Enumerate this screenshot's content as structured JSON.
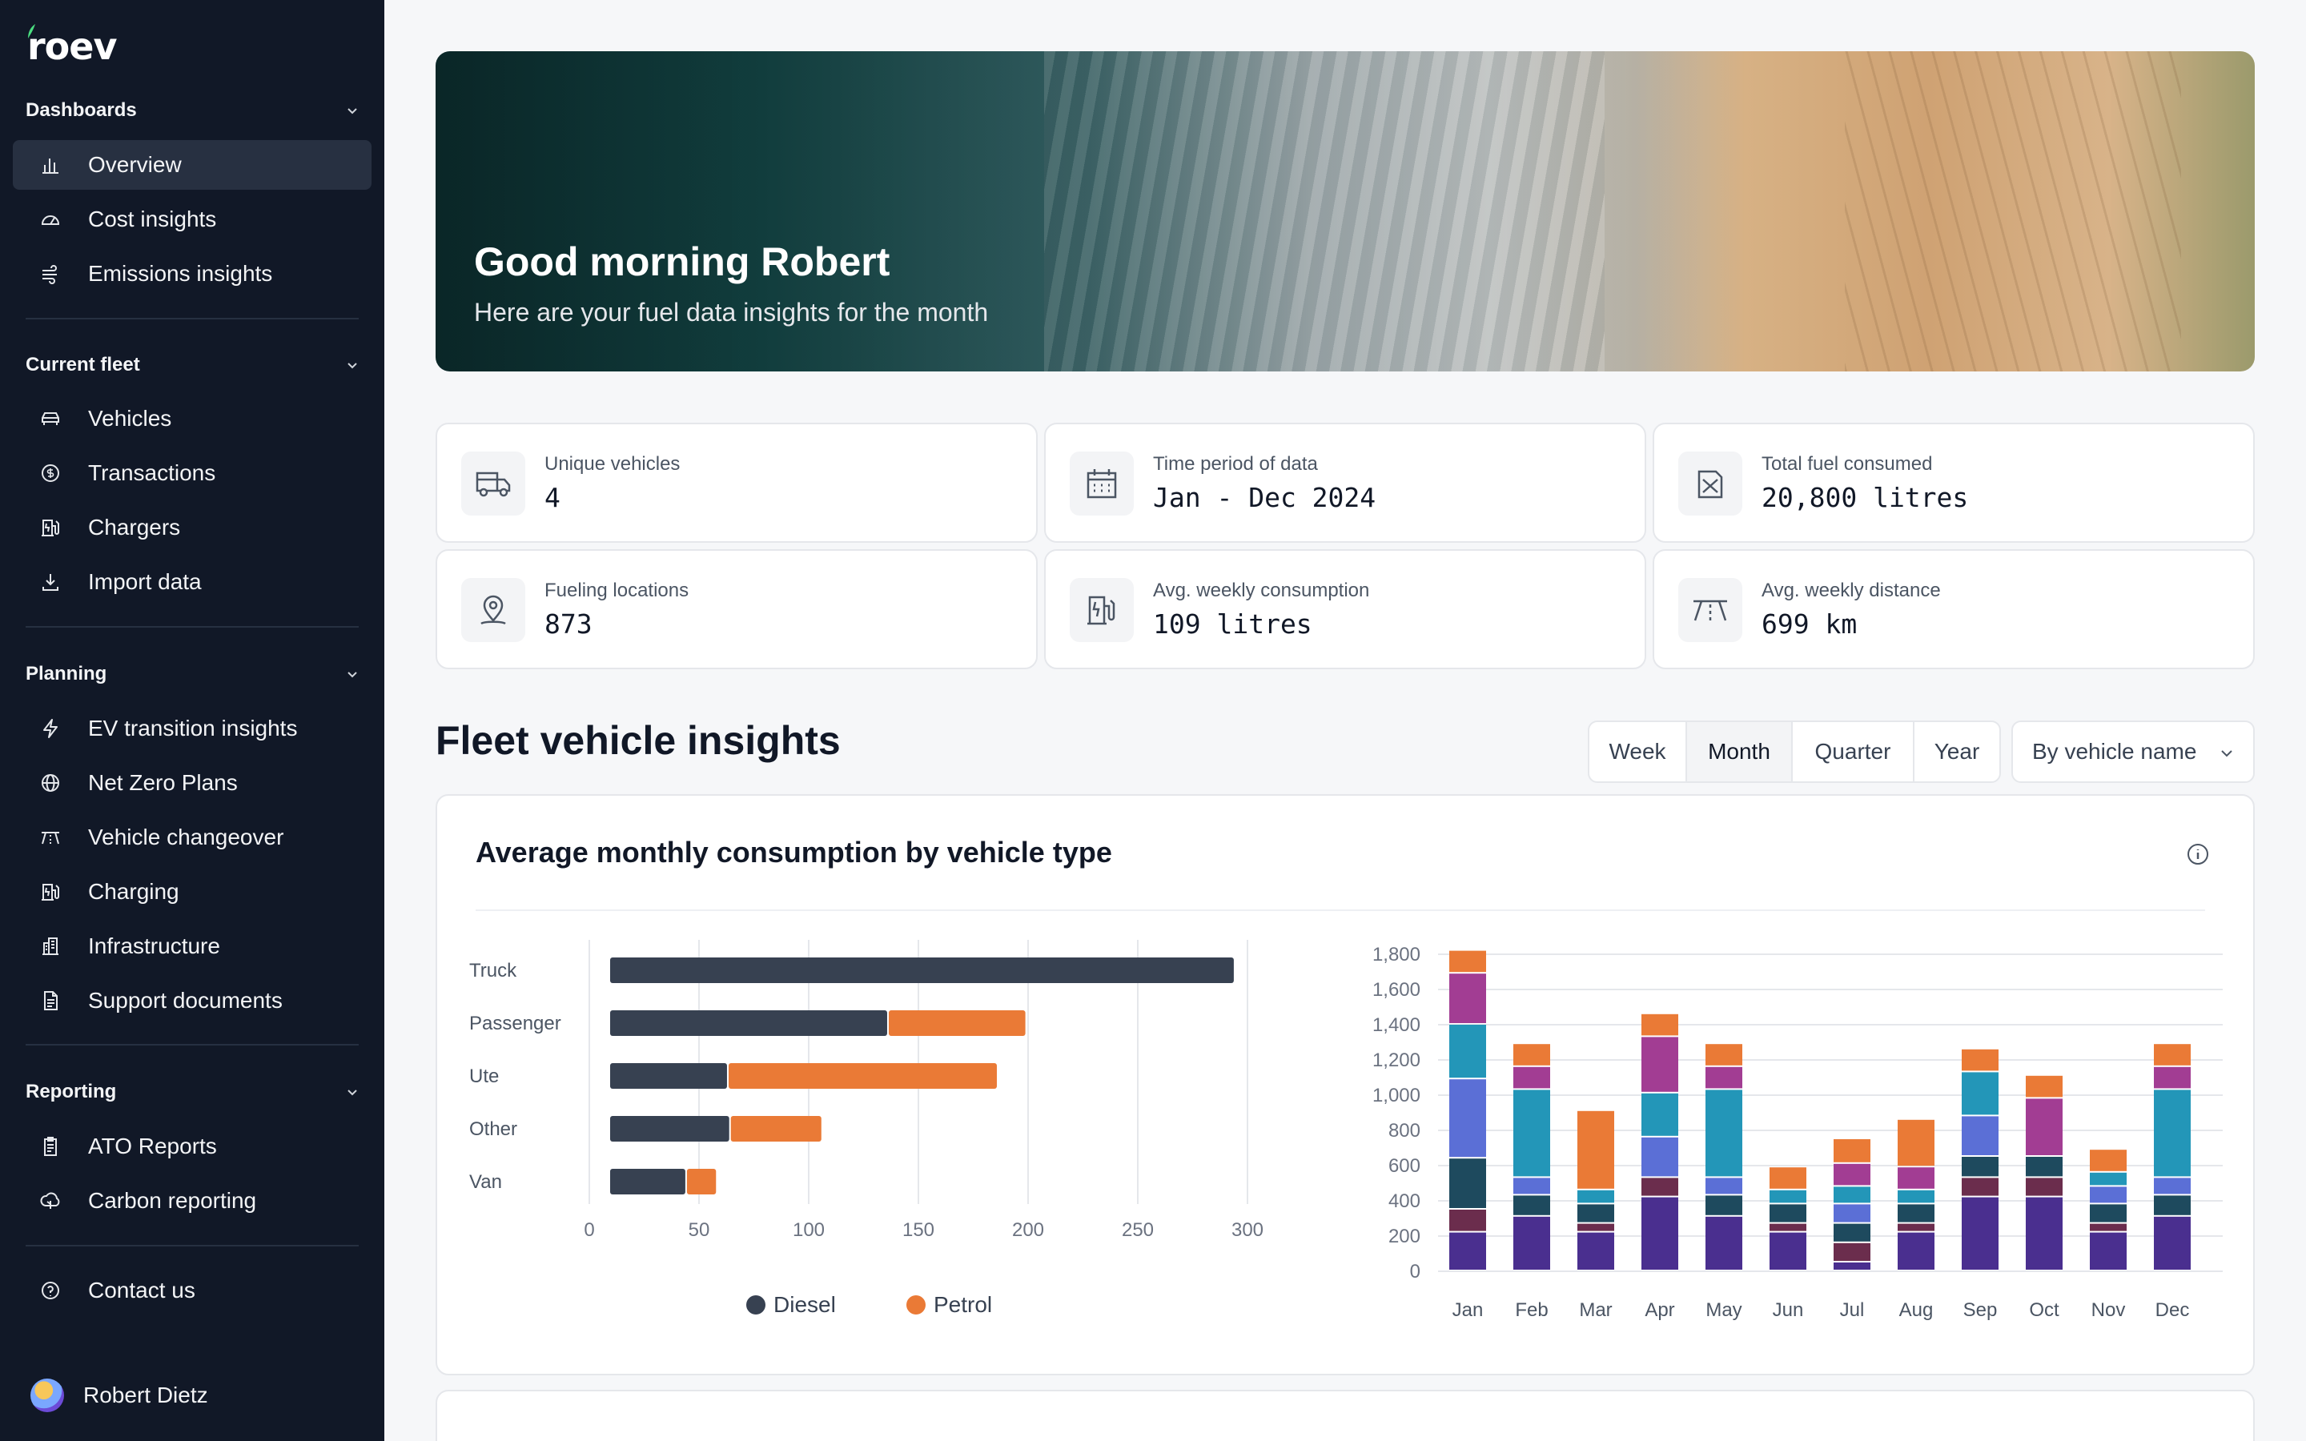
{
  "app": {
    "logo": "roev"
  },
  "sidebar": {
    "sections": [
      {
        "title": "Dashboards",
        "items": [
          {
            "label": "Overview",
            "icon": "bar-chart-icon"
          },
          {
            "label": "Cost insights",
            "icon": "gauge-icon"
          },
          {
            "label": "Emissions insights",
            "icon": "wind-icon"
          }
        ]
      },
      {
        "title": "Current fleet",
        "items": [
          {
            "label": "Vehicles",
            "icon": "car-icon"
          },
          {
            "label": "Transactions",
            "icon": "dollar-icon"
          },
          {
            "label": "Chargers",
            "icon": "fuel-charger-icon"
          },
          {
            "label": "Import data",
            "icon": "download-icon"
          }
        ]
      },
      {
        "title": "Planning",
        "items": [
          {
            "label": "EV transition insights",
            "icon": "bolt-icon"
          },
          {
            "label": "Net Zero Plans",
            "icon": "globe-icon"
          },
          {
            "label": "Vehicle changeover",
            "icon": "road-icon"
          },
          {
            "label": "Charging",
            "icon": "fuel-charger-icon"
          },
          {
            "label": "Infrastructure",
            "icon": "building-icon"
          },
          {
            "label": "Support documents",
            "icon": "document-icon"
          }
        ]
      },
      {
        "title": "Reporting",
        "items": [
          {
            "label": "ATO Reports",
            "icon": "clipboard-icon"
          },
          {
            "label": "Carbon reporting",
            "icon": "leaf-cloud-icon"
          }
        ]
      }
    ],
    "contact": "Contact us",
    "user": "Robert Dietz"
  },
  "hero": {
    "title": "Good morning Robert",
    "subtitle": "Here are your fuel data insights for the month"
  },
  "stats": [
    {
      "label": "Unique vehicles",
      "value": "4",
      "icon": "truck-icon"
    },
    {
      "label": "Time period of data",
      "value": "Jan - Dec 2024",
      "icon": "calendar-icon"
    },
    {
      "label": "Total fuel consumed",
      "value": "20,800 litres",
      "icon": "fuel-icon"
    },
    {
      "label": "Fueling locations",
      "value": "873",
      "icon": "map-pin-icon"
    },
    {
      "label": "Avg. weekly consumption",
      "value": "109 litres",
      "icon": "fuel-pump-icon"
    },
    {
      "label": "Avg. weekly distance",
      "value": "699 km",
      "icon": "road-icon"
    }
  ],
  "insights": {
    "title": "Fleet vehicle insights",
    "periods": [
      "Week",
      "Month",
      "Quarter",
      "Year"
    ],
    "selected_period": "Month",
    "group_by": "By vehicle name"
  },
  "card": {
    "title": "Average monthly consumption by vehicle type"
  },
  "colors": {
    "diesel": "#374151",
    "petrol": "#ea7a36",
    "sidebar": "#111827"
  },
  "chart_data": [
    {
      "type": "bar",
      "orientation": "horizontal",
      "stacked": true,
      "categories": [
        "Truck",
        "Passenger",
        "Ute",
        "Other",
        "Van"
      ],
      "series": [
        {
          "name": "Diesel",
          "color": "#374151",
          "values": [
            285,
            127,
            54,
            55,
            35
          ]
        },
        {
          "name": "Petrol",
          "color": "#ea7a36",
          "values": [
            0,
            63,
            123,
            42,
            14
          ]
        }
      ],
      "xlim": [
        0,
        300
      ],
      "xticks": [
        0,
        50,
        100,
        150,
        200,
        250,
        300
      ],
      "grid": true,
      "legend": "bottom"
    },
    {
      "type": "bar",
      "stacked": true,
      "categories": [
        "Jan",
        "Feb",
        "Mar",
        "Apr",
        "May",
        "Jun",
        "Jul",
        "Aug",
        "Sep",
        "Oct",
        "Nov",
        "Dec"
      ],
      "ylim": [
        0,
        1800
      ],
      "yticks": [
        "0",
        "200",
        "400",
        "600",
        "800",
        "1,000",
        "1,200",
        "1,400",
        "1,600",
        "1,800"
      ],
      "grid": true,
      "series": [
        {
          "color": "#4a2f8f",
          "values": [
            220,
            310,
            220,
            420,
            310,
            220,
            50,
            220,
            420,
            420,
            220,
            310
          ]
        },
        {
          "color": "#6b2d4d",
          "values": [
            130,
            0,
            50,
            110,
            0,
            50,
            110,
            50,
            110,
            110,
            50,
            0
          ]
        },
        {
          "color": "#1e4a5e",
          "values": [
            290,
            120,
            110,
            0,
            120,
            110,
            110,
            110,
            120,
            120,
            110,
            120
          ]
        },
        {
          "color": "#5b6fd6",
          "values": [
            450,
            100,
            0,
            230,
            100,
            0,
            110,
            0,
            230,
            0,
            100,
            100
          ]
        },
        {
          "color": "#2396b8",
          "values": [
            310,
            500,
            80,
            250,
            500,
            80,
            100,
            80,
            250,
            0,
            80,
            500
          ]
        },
        {
          "color": "#a23d93",
          "values": [
            290,
            130,
            0,
            320,
            130,
            0,
            130,
            130,
            0,
            330,
            0,
            130
          ]
        },
        {
          "color": "#ea7a36",
          "values": [
            130,
            130,
            450,
            130,
            130,
            130,
            140,
            270,
            130,
            130,
            130,
            130
          ]
        }
      ]
    }
  ]
}
